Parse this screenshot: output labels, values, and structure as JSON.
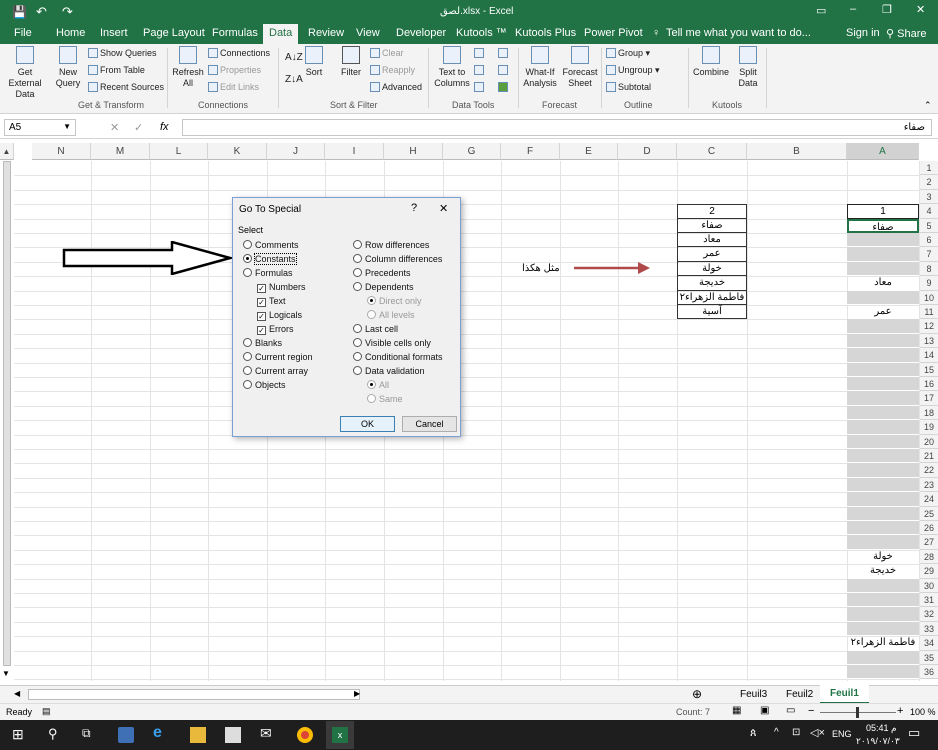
{
  "titlebar": {
    "title": "لصق.xlsx - Excel"
  },
  "tabs": [
    "File",
    "Home",
    "Insert",
    "Page Layout",
    "Formulas",
    "Data",
    "Review",
    "View",
    "Developer",
    "Kutools ™",
    "Kutools Plus",
    "Power Pivot"
  ],
  "tellme": "Tell me what you want to do...",
  "signin": "Sign in",
  "share": "Share",
  "ribbon": {
    "get_external": "Get External Data",
    "new_query": "New Query",
    "show_queries": "Show Queries",
    "from_table": "From Table",
    "recent_sources": "Recent Sources",
    "refresh_all": "Refresh All",
    "connections": "Connections",
    "properties": "Properties",
    "edit_links": "Edit Links",
    "sort": "Sort",
    "filter": "Filter",
    "clear": "Clear",
    "reapply": "Reapply",
    "advanced": "Advanced",
    "text_to_columns": "Text to Columns",
    "whatif": "What-If Analysis",
    "forecast_sheet": "Forecast Sheet",
    "group": "Group",
    "ungroup": "Ungroup",
    "subtotal": "Subtotal",
    "combine": "Combine",
    "split_data": "Split Data",
    "groups": [
      "Get & Transform",
      "Connections",
      "Sort & Filter",
      "Data Tools",
      "Forecast",
      "Outline",
      "Kutools"
    ]
  },
  "formula": {
    "namebox": "A5",
    "fx": "fx",
    "content": "صفاء"
  },
  "columns": [
    "N",
    "M",
    "L",
    "K",
    "J",
    "I",
    "H",
    "G",
    "F",
    "E",
    "D",
    "C",
    "B",
    "A"
  ],
  "rows": [
    "1",
    "2",
    "3",
    "4",
    "5",
    "6",
    "7",
    "8",
    "9",
    "10",
    "11",
    "12",
    "13",
    "14",
    "15",
    "16",
    "17",
    "18",
    "19",
    "20",
    "21",
    "22",
    "23",
    "24",
    "25",
    "26",
    "27",
    "28",
    "29",
    "30",
    "31",
    "32",
    "33",
    "34",
    "35",
    "36"
  ],
  "colC": [
    "2",
    "صفاء",
    "معاد",
    "عمر",
    "خولة",
    "خديجة",
    "فاطمة الزهراء٢",
    "آسية"
  ],
  "colA_text": {
    "r4": "1",
    "r5": "صفاء",
    "r9": "معاد",
    "r11": "عمر",
    "r28": "خولة",
    "r29": "خديجة",
    "r34": "فاطمة الزهراء٢"
  },
  "annotation": "مثل هكذا",
  "dialog": {
    "title": "Go To Special",
    "help": "?",
    "close": "✕",
    "select": "Select",
    "left": [
      "Comments",
      "Constants",
      "Formulas",
      "Numbers",
      "Text",
      "Logicals",
      "Errors",
      "Blanks",
      "Current region",
      "Current array",
      "Objects"
    ],
    "right": [
      "Row differences",
      "Column differences",
      "Precedents",
      "Dependents",
      "Direct only",
      "All levels",
      "Last cell",
      "Visible cells only",
      "Conditional formats",
      "Data validation",
      "All",
      "Same"
    ],
    "ok": "OK",
    "cancel": "Cancel"
  },
  "sheets": [
    "Feuil3",
    "Feuil2",
    "Feuil1"
  ],
  "status": {
    "ready": "Ready",
    "count": "Count: 7",
    "zoom": "100 %"
  },
  "taskbar": {
    "lang": "ENG",
    "time": "05:41 م",
    "date": "٢٠١٩/٠٧/٠٣"
  }
}
